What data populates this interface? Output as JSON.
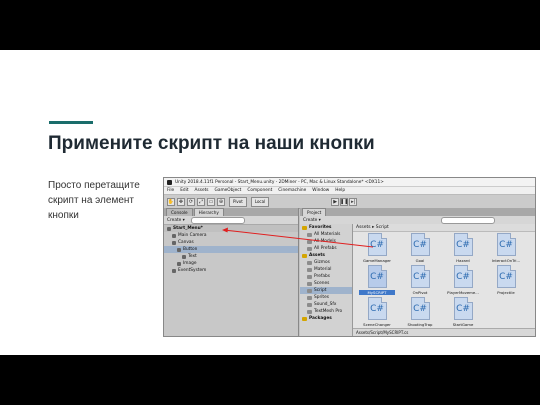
{
  "slide": {
    "title": "Примените скрипт на наши кнопки",
    "body": "Просто перетащите скрипт на элемент кнопки",
    "accent_color": "#1a6d6b"
  },
  "unity": {
    "window_title": "Unity 2018.4.11f1 Personal - Start_Menu.unity - 2DMiner - PC, Mac & Linux Standalone* <DX11>",
    "menu": [
      "File",
      "Edit",
      "Assets",
      "GameObject",
      "Component",
      "Cinemachine",
      "Window",
      "Help"
    ],
    "toolbar": {
      "pivot": "Pivot",
      "local": "Local"
    },
    "hierarchy": {
      "tabs": [
        "Console",
        "Hierarchy"
      ],
      "create": "Create ▾",
      "rows": [
        {
          "label": "Start_Menu*",
          "indent": 0
        },
        {
          "label": "Main Camera",
          "indent": 1
        },
        {
          "label": "Canvas",
          "indent": 1
        },
        {
          "label": "Button",
          "indent": 2
        },
        {
          "label": "Text",
          "indent": 3
        },
        {
          "label": "Image",
          "indent": 2
        },
        {
          "label": "EventSystem",
          "indent": 1
        }
      ],
      "selected_index": 3
    },
    "project": {
      "tab": "Project",
      "create": "Create ▾",
      "folders": [
        {
          "label": "Favorites",
          "head": true
        },
        {
          "label": "All Materials"
        },
        {
          "label": "All Models"
        },
        {
          "label": "All Prefabs"
        },
        {
          "label": "Assets",
          "head": true
        },
        {
          "label": "Gizmos"
        },
        {
          "label": "Material"
        },
        {
          "label": "Prefabs"
        },
        {
          "label": "Scenes"
        },
        {
          "label": "Script",
          "selected": true
        },
        {
          "label": "Sprites"
        },
        {
          "label": "Sound_Sfx"
        },
        {
          "label": "TextMesh Pro"
        },
        {
          "label": "Packages",
          "head": true
        }
      ],
      "breadcrumb": "Assets ▸ Script",
      "assets": [
        {
          "label": "GameManager",
          "icon": "C#"
        },
        {
          "label": "Goal",
          "icon": "C#"
        },
        {
          "label": "Hazard",
          "icon": "C#"
        },
        {
          "label": "InteractOnTri...",
          "icon": "C#"
        },
        {
          "label": "MySCRIPT",
          "icon": "C#",
          "selected": true
        },
        {
          "label": "OnPivot",
          "icon": "C#"
        },
        {
          "label": "PlayerMoveme...",
          "icon": "C#"
        },
        {
          "label": "Projectile",
          "icon": "C#"
        },
        {
          "label": "SceneChanger",
          "icon": "C#"
        },
        {
          "label": "ShootingTrap",
          "icon": "C#"
        },
        {
          "label": "StartGame",
          "icon": "C#"
        }
      ],
      "status_path": "Assets/Script/MySCRIPT.cs"
    },
    "drag_arrow_color": "#e02020"
  }
}
